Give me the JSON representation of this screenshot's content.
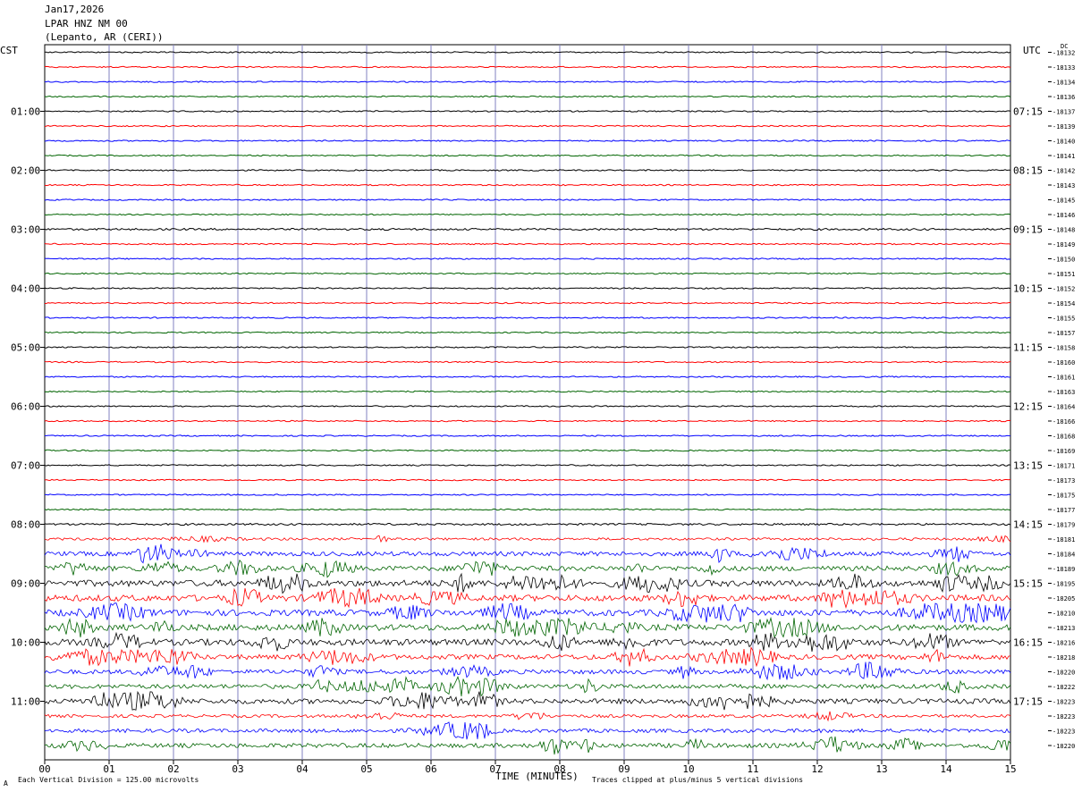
{
  "header": {
    "date": "Jan17,2026",
    "station": "LPAR HNZ NM 00",
    "location": "(Lepanto, AR (CERI))"
  },
  "left_timezone": "CST",
  "right_timezone": "UTC",
  "dc_label": "DC",
  "footer": {
    "scale": "Each Vertical Division =  125.00 microvolts",
    "clip": "Traces clipped at plus/minus 5 vertical divisions",
    "corner_mark": "A"
  },
  "chart_data": {
    "type": "line",
    "xlabel": "TIME (MINUTES)",
    "xlim": [
      0,
      15
    ],
    "x_ticks": [
      "00",
      "01",
      "02",
      "03",
      "04",
      "05",
      "06",
      "07",
      "08",
      "09",
      "10",
      "11",
      "12",
      "13",
      "14",
      "15"
    ],
    "trace_colors": [
      "#000000",
      "#ff0000",
      "#0000ff",
      "#006400"
    ],
    "left_hour_labels": [
      "01:00",
      "02:00",
      "03:00",
      "04:00",
      "05:00",
      "06:00",
      "07:00",
      "08:00",
      "09:00",
      "10:00",
      "11:00"
    ],
    "right_hour_labels": [
      "07:15",
      "08:15",
      "09:15",
      "10:15",
      "11:15",
      "12:15",
      "13:15",
      "14:15",
      "15:15",
      "16:15",
      "17:15"
    ],
    "dc_offsets": [
      "-18132",
      "-18133",
      "-18134",
      "-18136",
      "-18137",
      "-18139",
      "-18140",
      "-18141",
      "-18142",
      "-18143",
      "-18145",
      "-18146",
      "-18148",
      "-18149",
      "-18150",
      "-18151",
      "-18152",
      "-18154",
      "-18155",
      "-18157",
      "-18158",
      "-18160",
      "-18161",
      "-18163",
      "-18164",
      "-18166",
      "-18168",
      "-18169",
      "-18171",
      "-18173",
      "-18175",
      "-18177",
      "-18179",
      "-18181",
      "-18184",
      "-18189",
      "-18195",
      "-18205",
      "-18210",
      "-18213",
      "-18216",
      "-18218",
      "-18220",
      "-18222",
      "-18223",
      "-18223",
      "-18223",
      "-18220"
    ],
    "trace_activity": [
      1,
      1,
      1,
      1,
      1,
      1,
      1,
      1,
      1,
      1,
      1,
      1,
      2,
      1,
      1,
      1,
      1,
      1,
      1,
      1,
      1,
      1,
      1,
      1,
      1,
      1,
      1,
      1,
      1,
      1,
      1,
      1,
      2,
      3,
      6,
      7,
      9,
      9,
      9,
      9,
      9,
      7,
      6,
      6,
      7,
      4,
      5,
      6
    ],
    "amplitude_scale_uv_per_division": 125.0,
    "clip_divisions": 5
  }
}
